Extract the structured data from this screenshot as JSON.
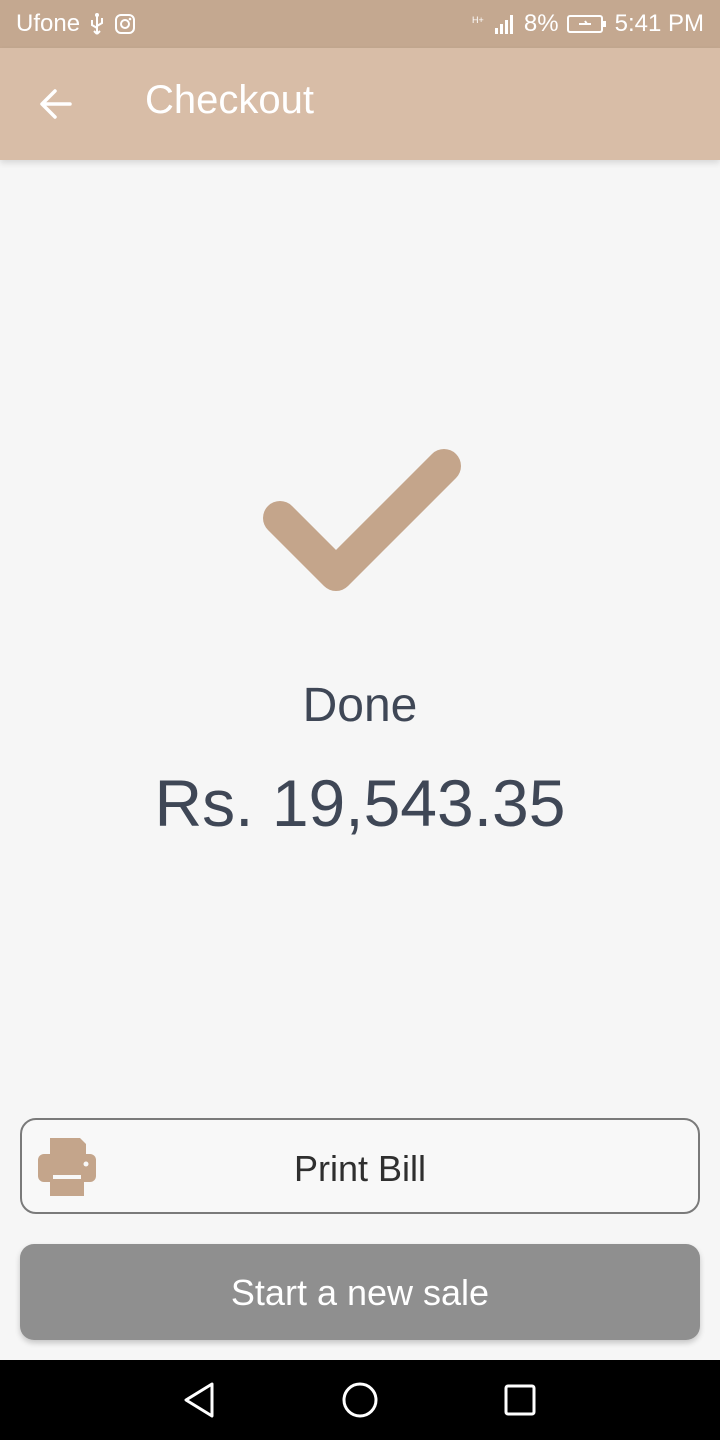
{
  "status_bar": {
    "carrier": "Ufone",
    "network": "H+",
    "battery": "8%",
    "time": "5:41 PM"
  },
  "app_bar": {
    "title": "Checkout",
    "back_icon": "arrow-left-icon"
  },
  "result": {
    "icon": "checkmark-icon",
    "status": "Done",
    "amount": "Rs. 19,543.35"
  },
  "actions": {
    "print_label": "Print Bill",
    "print_icon": "printer-icon",
    "new_sale_label": "Start a new sale"
  },
  "nav": [
    "back-triangle-icon",
    "home-circle-icon",
    "recents-square-icon"
  ],
  "colors": {
    "accent": "#c4a58b",
    "app_bar": "#d8bda7",
    "status_bar": "#c4a890",
    "text_dark": "#3f4756",
    "button_gray": "#8f8f8f"
  }
}
